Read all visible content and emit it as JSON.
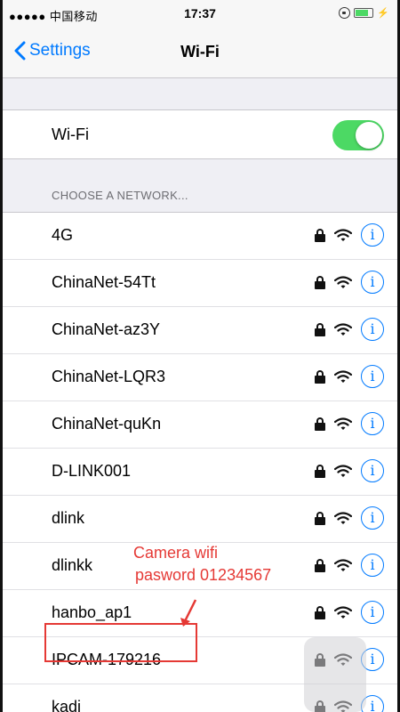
{
  "status_bar": {
    "carrier": "●●●●● 中国移动",
    "time": "17:37"
  },
  "nav": {
    "back_label": "Settings",
    "title": "Wi-Fi"
  },
  "wifi_toggle": {
    "label": "Wi-Fi",
    "on": true
  },
  "section_header": "CHOOSE A NETWORK...",
  "networks": [
    {
      "name": "4G"
    },
    {
      "name": "ChinaNet-54Tt"
    },
    {
      "name": "ChinaNet-az3Y"
    },
    {
      "name": "ChinaNet-LQR3"
    },
    {
      "name": "ChinaNet-quKn"
    },
    {
      "name": "D-LINK001"
    },
    {
      "name": "dlink"
    },
    {
      "name": "dlinkk"
    },
    {
      "name": "hanbo_ap1"
    },
    {
      "name": "IPCAM-179216"
    },
    {
      "name": "kadi"
    }
  ],
  "info_glyph": "i",
  "annotation": {
    "line1": "Camera wifi",
    "line2": "pasword 01234567"
  },
  "colors": {
    "accent": "#007aff",
    "toggle_on": "#4cd964",
    "annotation": "#e53935"
  }
}
